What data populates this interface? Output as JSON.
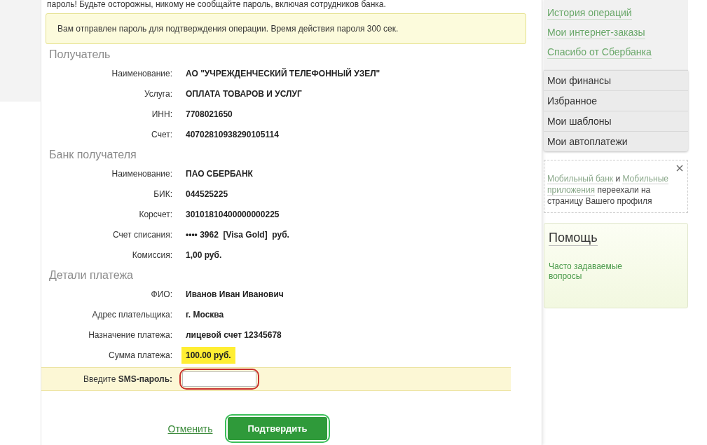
{
  "warning": "пароль! Будьте осторожны, никому не сообщайте пароль, включая сотрудников банка.",
  "notice": "Вам отправлен пароль для подтверждения операции. Время действия пароля 300 сек.",
  "sections": [
    {
      "title": "Получатель",
      "fields": [
        {
          "label": "Наименование:",
          "value": "АО \"УЧРЕЖДЕНЧЕСКИЙ ТЕЛЕФОННЫЙ УЗЕЛ\"",
          "highlighted": false
        },
        {
          "label": "Услуга:",
          "value": "ОПЛАТА ТОВАРОВ И УСЛУГ",
          "highlighted": false
        },
        {
          "label": "ИНН:",
          "value": "7708021650",
          "highlighted": false
        },
        {
          "label": "Счет:",
          "value": "40702810938290105114",
          "highlighted": false
        }
      ]
    },
    {
      "title": "Банк получателя",
      "fields": [
        {
          "label": "Наименование:",
          "value": "ПАО СБЕРБАНК",
          "highlighted": false
        },
        {
          "label": "БИК:",
          "value": "044525225",
          "highlighted": false
        },
        {
          "label": "Корсчет:",
          "value": "30101810400000000225",
          "highlighted": false
        },
        {
          "label": "Счет списания:",
          "value": "•••• 3962  [Visa Gold]  руб.",
          "highlighted": false
        },
        {
          "label": "Комиссия:",
          "value": "1,00 руб.",
          "highlighted": false
        }
      ]
    },
    {
      "title": "Детали платежа",
      "fields": [
        {
          "label": "ФИО:",
          "value": "Иванов Иван Иванович",
          "highlighted": false
        },
        {
          "label": "Адрес плательщика:",
          "value": "г. Москва",
          "highlighted": false
        },
        {
          "label": "Назначение платежа:",
          "value": "лицевой счет 12345678",
          "highlighted": false
        },
        {
          "label": "Сумма платежа:",
          "value": "100.00 руб.",
          "highlighted": true
        }
      ]
    }
  ],
  "sms": {
    "label": "Введите **SMS-пароль:**",
    "circled": true
  },
  "cancel": "Отменить",
  "confirm": {
    "label": "Подтвердить",
    "circled": true
  },
  "sidebar": {
    "links": [
      "История операций",
      "Мои интернет-заказы",
      "Спасибо от Сбербанка"
    ],
    "menu": [
      "Мои финансы",
      "Избранное",
      "Мои шаблоны",
      "Мои автоплатежи"
    ],
    "tip": [
      {
        "kind": "link",
        "text": "Мобильный банк"
      },
      {
        "kind": "plain",
        "text": " и "
      },
      {
        "kind": "link",
        "text": "Мобильные"
      },
      {
        "kind": "linebreak"
      },
      {
        "kind": "link",
        "text": "приложения"
      },
      {
        "kind": "plain",
        "text": " переехали на страницу Вашего профиля"
      }
    ],
    "help": {
      "title": "Помощь",
      "link": "Часто задаваемые вопросы"
    }
  }
}
